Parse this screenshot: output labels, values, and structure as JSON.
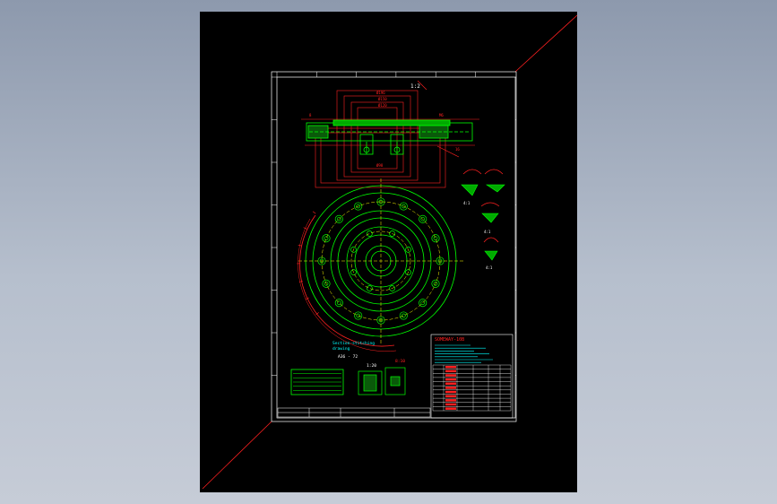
{
  "viewer": {
    "background_top": "#8d99ad",
    "background_bottom": "#c6ccd7",
    "canvas_color": "#000000"
  },
  "drawing": {
    "colors": {
      "border": "#ffffff",
      "geometry": "#00ff00",
      "dimension": "#ff2020",
      "text": "#ffffff",
      "note": "#00ffff",
      "hatch": "#00aa00",
      "crosshair": "#ff2020"
    },
    "scale_mark": "1:2",
    "detail_labels": [
      "4:1",
      "4:1",
      "4:1"
    ],
    "section_note_lines": [
      "Section-stitching",
      "drawing"
    ],
    "section_note_value": "A36 - 72",
    "small_scale": "1:20",
    "small_note": "8:10"
  },
  "title_block": {
    "heading": "SOMEWAY-10B",
    "subtitle_rows": 7,
    "table_rows": 11
  },
  "notes_box": {
    "rows": 6
  }
}
